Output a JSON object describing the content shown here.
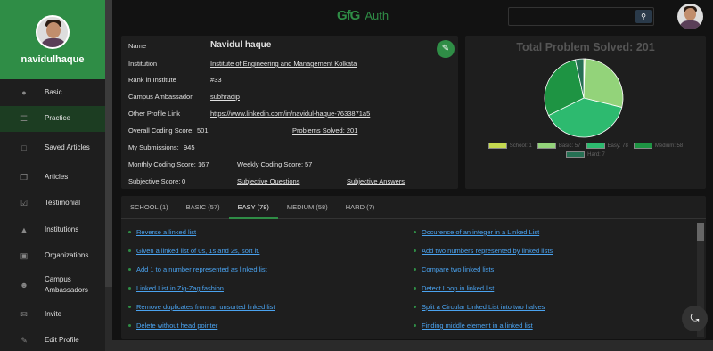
{
  "sidebar": {
    "username": "navidulhaque",
    "items": [
      {
        "label": "Basic",
        "icon": "person-icon"
      },
      {
        "label": "Practice",
        "icon": "code-icon"
      },
      {
        "label": "Saved Articles",
        "icon": "bookmark-icon"
      },
      {
        "label": "Articles",
        "icon": "copy-icon"
      },
      {
        "label": "Testimonial",
        "icon": "checklist-icon"
      },
      {
        "label": "Institutions",
        "icon": "graduation-cap-icon"
      },
      {
        "label": "Organizations",
        "icon": "building-icon"
      },
      {
        "label": "Campus Ambassadors",
        "icon": "ambassador-icon"
      },
      {
        "label": "Invite",
        "icon": "mail-icon"
      },
      {
        "label": "Edit Profile",
        "icon": "pencil-icon"
      }
    ]
  },
  "header": {
    "logo_glyph": "GfG",
    "logo_text": "Auth",
    "search_placeholder": ""
  },
  "profile": {
    "name_label": "Name",
    "name": "Navidul haque",
    "institution_label": "Institution",
    "institution": "Institute of Engineering and Management Kolkata",
    "rank_label": "Rank in Institute",
    "rank": "#33",
    "ambassador_label": "Campus Ambassador",
    "ambassador": "subhradip",
    "link_label": "Other Profile Link",
    "link": "https://www.linkedin.com/in/navidul-haque-7633871a5",
    "coding_score_label": "Overall Coding Score:",
    "coding_score": "501",
    "problems_solved_link": "Problems Solved: 201",
    "submissions_label": "My Submissions:",
    "submissions": "945",
    "monthly_label": "Monthly Coding Score:",
    "monthly": "167",
    "weekly_label": "Weekly Coding Score:",
    "weekly": "57",
    "subjective_label": "Subjective Score:",
    "subjective": "0",
    "subjective_questions": "Subjective Questions",
    "subjective_answers": "Subjective Answers"
  },
  "chart_data": {
    "type": "pie",
    "title": "Total Problem Solved: 201",
    "legend_position": "bottom",
    "categories": [
      "School",
      "Basic",
      "Easy",
      "Medium",
      "Hard"
    ],
    "values": [
      1,
      57,
      78,
      58,
      7
    ],
    "colors": [
      "#c4d94f",
      "#93d37a",
      "#2dba6f",
      "#1e9443",
      "#267054"
    ],
    "legend_labels": [
      "School: 1",
      "Basic: 57",
      "Easy: 78",
      "Medium: 58",
      "Hard: 7"
    ]
  },
  "tabs": [
    "SCHOOL (1)",
    "BASIC (57)",
    "EASY (78)",
    "MEDIUM (58)",
    "HARD (7)"
  ],
  "active_tab": 2,
  "problems_left": [
    "Reverse a linked list",
    "Given a linked list of 0s, 1s and 2s, sort it.",
    "Add 1 to a number represented as linked list",
    "Linked List in Zig-Zag fashion",
    "Remove duplicates from an unsorted linked list",
    "Delete without head pointer"
  ],
  "problems_right": [
    "Occurence of an integer in a Linked List",
    "Add two numbers represented by linked lists",
    "Compare two linked lists",
    "Detect Loop in linked list",
    "Split a Circular Linked List into two halves",
    "Finding middle element in a linked list"
  ],
  "accent_color": "#2f8d46"
}
